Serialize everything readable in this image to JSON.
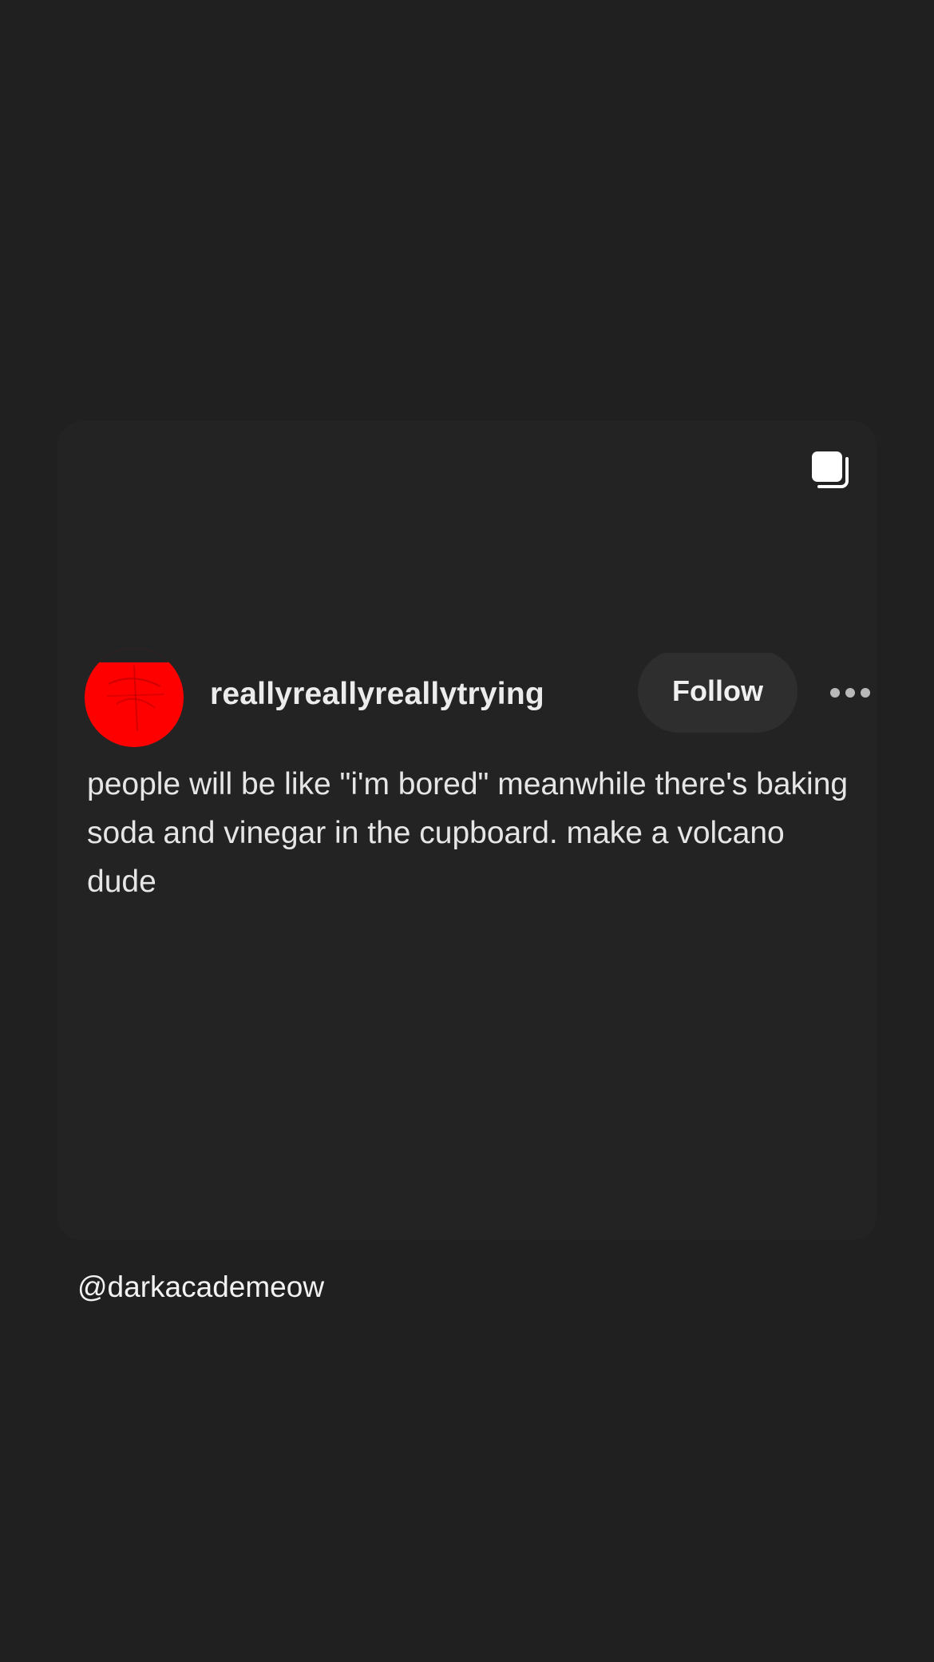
{
  "post": {
    "username": "reallyreallyreallytrying",
    "follow_label": "Follow",
    "more_label": "•••",
    "text": "people will be like \"i'm bored\" meanwhile there's baking soda and vinegar in the cupboard. make a volcano dude",
    "avatar_color": "#ff0000"
  },
  "icons": {
    "multi": "multiple-images-icon",
    "more": "more-options-icon"
  },
  "watermark": {
    "handle": "@darkacademeow"
  },
  "colors": {
    "background": "#202020",
    "card": "#232323",
    "follow_button": "#2e2e2e",
    "text": "#e6e6e6"
  }
}
